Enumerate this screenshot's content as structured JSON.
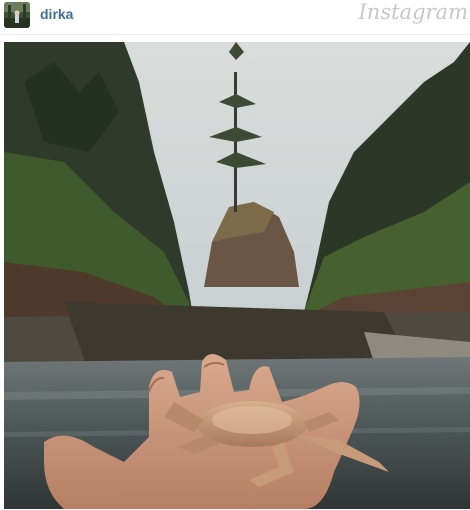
{
  "post": {
    "username": "dirka",
    "brand": "Instagram"
  },
  "icons": {
    "avatar": "user-avatar-photo",
    "photo": "post-photo"
  },
  "colors": {
    "username": "#3f6f97",
    "brand": "#c8c8c8",
    "divider": "#ececec"
  }
}
